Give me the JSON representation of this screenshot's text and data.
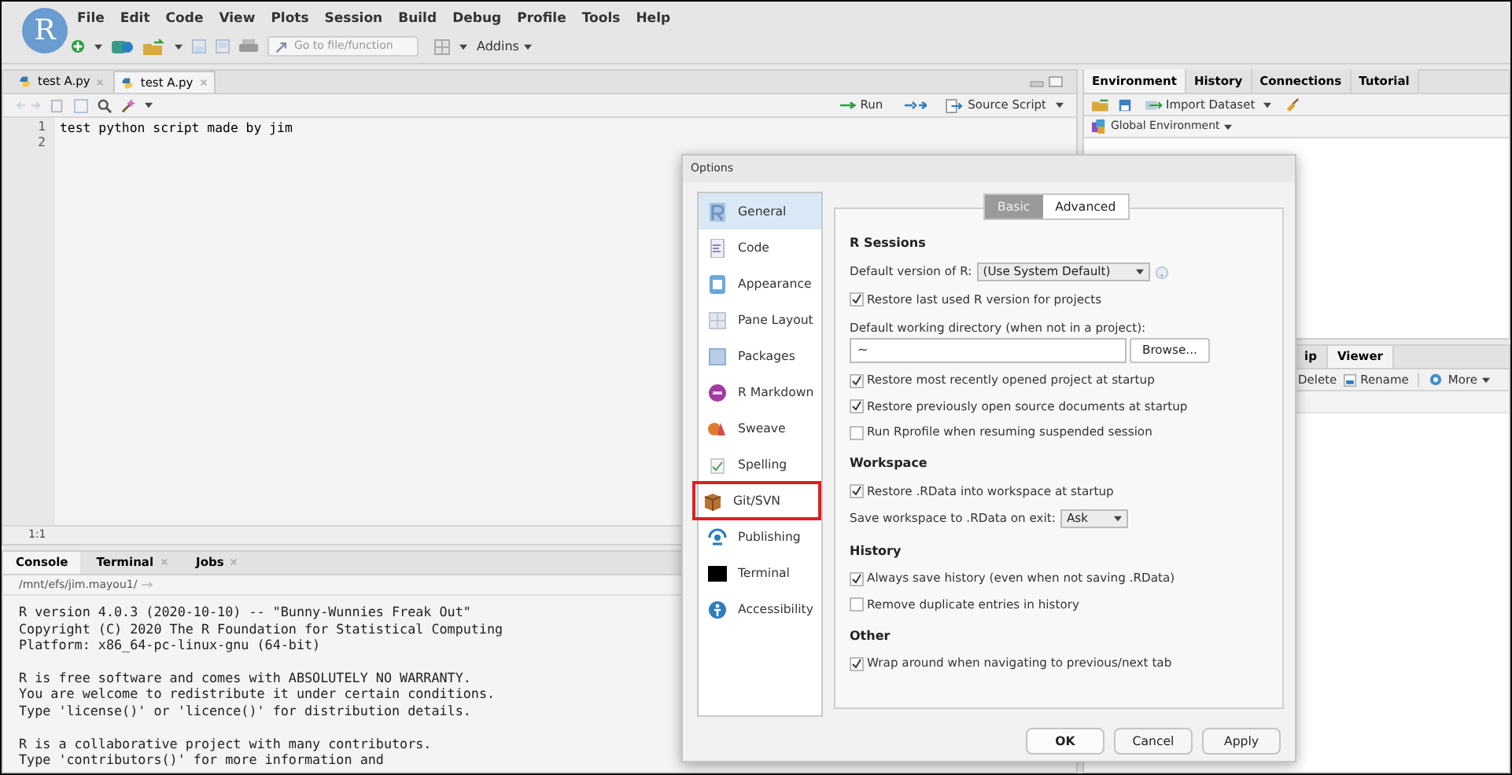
{
  "app": {
    "logo": "R"
  },
  "menu": [
    "File",
    "Edit",
    "Code",
    "View",
    "Plots",
    "Session",
    "Build",
    "Debug",
    "Profile",
    "Tools",
    "Help"
  ],
  "toolbar": {
    "goto_placeholder": "Go to file/function",
    "addins": "Addins"
  },
  "source": {
    "tabs": [
      {
        "label": "test A.py",
        "selected": false
      },
      {
        "label": "test A.py",
        "selected": true
      }
    ],
    "run": "Run",
    "source_script": "Source Script",
    "line_numbers": [
      "1",
      "2"
    ],
    "code": [
      "test python script made by jim"
    ],
    "cursor": "1:1"
  },
  "console": {
    "tabs": [
      {
        "label": "Console",
        "selected": true,
        "closable": false
      },
      {
        "label": "Terminal",
        "selected": false,
        "closable": true
      },
      {
        "label": "Jobs",
        "selected": false,
        "closable": true
      }
    ],
    "path": "/mnt/efs/jim.mayou1/",
    "output": [
      [
        "R version 4.0.3 (2020-10-10) -- \"Bunny-Wunnies Freak Out\"",
        "Copyright (C) 2020 The R Foundation for Statistical Computing",
        "Platform: x86_64-pc-linux-gnu (64-bit)"
      ],
      [
        "R is free software and comes with ABSOLUTELY NO WARRANTY.",
        "You are welcome to redistribute it under certain conditions.",
        "Type 'license()' or 'licence()' for distribution details."
      ],
      [
        "R is a collaborative project with many contributors.",
        "Type 'contributors()' for more information and"
      ]
    ]
  },
  "environment": {
    "tabs": [
      {
        "label": "Environment",
        "selected": true
      },
      {
        "label": "History",
        "selected": false
      },
      {
        "label": "Connections",
        "selected": false
      },
      {
        "label": "Tutorial",
        "selected": false
      }
    ],
    "import": "Import Dataset",
    "scope": "Global Environment"
  },
  "files": {
    "tabs": [
      {
        "label": "ip",
        "selected": false
      },
      {
        "label": "Viewer",
        "selected": true
      }
    ],
    "actions": [
      "Delete",
      "Rename",
      "More"
    ]
  },
  "dialog": {
    "title": "Options",
    "categories": [
      {
        "label": "General",
        "selected": true,
        "highlighted": false
      },
      {
        "label": "Code",
        "selected": false,
        "highlighted": false
      },
      {
        "label": "Appearance",
        "selected": false,
        "highlighted": false
      },
      {
        "label": "Pane Layout",
        "selected": false,
        "highlighted": false
      },
      {
        "label": "Packages",
        "selected": false,
        "highlighted": false
      },
      {
        "label": "R Markdown",
        "selected": false,
        "highlighted": false
      },
      {
        "label": "Sweave",
        "selected": false,
        "highlighted": false
      },
      {
        "label": "Spelling",
        "selected": false,
        "highlighted": false
      },
      {
        "label": "Git/SVN",
        "selected": false,
        "highlighted": true
      },
      {
        "label": "Publishing",
        "selected": false,
        "highlighted": false
      },
      {
        "label": "Terminal",
        "selected": false,
        "highlighted": false
      },
      {
        "label": "Accessibility",
        "selected": false,
        "highlighted": false
      }
    ],
    "tabs": [
      {
        "label": "Basic",
        "selected": true
      },
      {
        "label": "Advanced",
        "selected": false
      }
    ],
    "sections": [
      {
        "title": "R Sessions",
        "items": [
          {
            "kind": "select",
            "label": "Default version of R:",
            "value": "(Use System Default)",
            "help": true
          },
          {
            "kind": "checkbox",
            "label": "Restore last used R version for projects",
            "checked": true
          },
          {
            "kind": "directory",
            "label": "Default working directory (when not in a project):",
            "value": "~",
            "button": "Browse..."
          },
          {
            "kind": "checkbox",
            "label": "Restore most recently opened project at startup",
            "checked": true
          },
          {
            "kind": "checkbox",
            "label": "Restore previously open source documents at startup",
            "checked": true
          },
          {
            "kind": "checkbox",
            "label": "Run Rprofile when resuming suspended session",
            "checked": false
          }
        ]
      },
      {
        "title": "Workspace",
        "items": [
          {
            "kind": "checkbox",
            "label": "Restore .RData into workspace at startup",
            "checked": true
          },
          {
            "kind": "select",
            "label": "Save workspace to .RData on exit:",
            "value": "Ask",
            "help": false
          }
        ]
      },
      {
        "title": "History",
        "items": [
          {
            "kind": "checkbox",
            "label": "Always save history (even when not saving .RData)",
            "checked": true
          },
          {
            "kind": "checkbox",
            "label": "Remove duplicate entries in history",
            "checked": false
          }
        ]
      },
      {
        "title": "Other",
        "items": [
          {
            "kind": "checkbox",
            "label": "Wrap around when navigating to previous/next tab",
            "checked": true
          }
        ]
      }
    ],
    "buttons": [
      {
        "label": "OK",
        "default": true
      },
      {
        "label": "Cancel",
        "default": false
      },
      {
        "label": "Apply",
        "default": false
      }
    ]
  }
}
